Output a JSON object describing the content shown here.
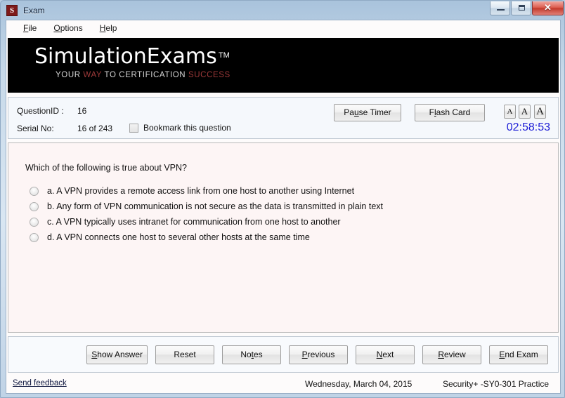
{
  "window": {
    "title": "Exam",
    "icon": "S",
    "buttons": {
      "minimize": "minimize",
      "maximize": "maximize",
      "close": "✕"
    }
  },
  "menu": [
    {
      "label": "File",
      "accel": "F"
    },
    {
      "label": "Options",
      "accel": "O"
    },
    {
      "label": "Help",
      "accel": "H"
    }
  ],
  "banner": {
    "logo": "SimulationExams",
    "trademark": "TM",
    "tagline_parts": [
      {
        "text": "YOUR ",
        "color": "white"
      },
      {
        "text": "WAY ",
        "color": "red"
      },
      {
        "text": "TO CERTIFICATION ",
        "color": "white"
      },
      {
        "text": "SUCCESS",
        "color": "red"
      }
    ],
    "tagline_full": "YOUR WAY TO CERTIFICATION SUCCESS"
  },
  "info": {
    "question_id_label": "QuestionID :",
    "question_id_value": "16",
    "serial_label": "Serial No:",
    "serial_value": "16 of 243",
    "bookmark_label": "Bookmark this question",
    "bookmark_checked": false,
    "pause_timer": "Pause Timer",
    "pause_timer_pre": "Pa",
    "pause_timer_accel": "u",
    "pause_timer_post": "se Timer",
    "flash_card_pre": "F",
    "flash_card_accel": "l",
    "flash_card_post": "ash Card",
    "font_small": "A",
    "font_medium": "A",
    "font_large": "A",
    "timer": "02:58:53",
    "timer_color": "#1d1dd6"
  },
  "question": {
    "text": "Which of the following is true about VPN?",
    "options": [
      {
        "id": "a",
        "label": "a. A VPN provides a remote access link from one host to another using Internet",
        "selected": false
      },
      {
        "id": "b",
        "label": "b. Any form of VPN communication is not secure as the data is transmitted in plain text",
        "selected": false
      },
      {
        "id": "c",
        "label": "c. A VPN typically uses intranet for communication from one host to another",
        "selected": false
      },
      {
        "id": "d",
        "label": "d. A VPN connects one host to several other hosts at the same time",
        "selected": false
      }
    ]
  },
  "actions": [
    {
      "name": "show-answer",
      "pre": "",
      "accel": "S",
      "post": "how Answer"
    },
    {
      "name": "reset",
      "pre": "Reset",
      "accel": "",
      "post": ""
    },
    {
      "name": "notes",
      "pre": "No",
      "accel": "t",
      "post": "es"
    },
    {
      "name": "previous",
      "pre": "",
      "accel": "P",
      "post": "revious"
    },
    {
      "name": "next",
      "pre": "",
      "accel": "N",
      "post": "ext"
    },
    {
      "name": "review",
      "pre": "",
      "accel": "R",
      "post": "eview"
    },
    {
      "name": "end-exam",
      "pre": "",
      "accel": "E",
      "post": "nd Exam"
    }
  ],
  "status": {
    "feedback": "Send feedback",
    "date": "Wednesday, March 04, 2015",
    "exam": "Security+ -SY0-301 Practice"
  },
  "colors": {
    "banner_bg": "#000000",
    "question_bg": "#fdf5f5",
    "info_bg": "#f5f8fc",
    "accent_red": "#9e3a3a",
    "timer_blue": "#1d1dd6"
  }
}
